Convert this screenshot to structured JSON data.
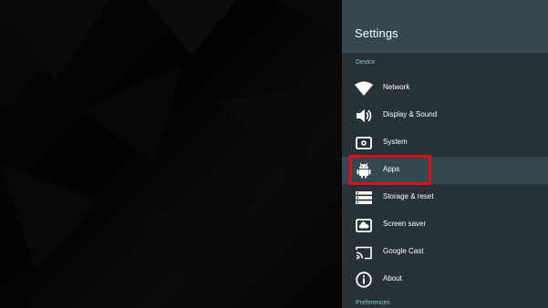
{
  "background": {
    "color": "#050505"
  },
  "settings": {
    "title": "Settings",
    "header_color": "#37474f",
    "panel_color": "#263238",
    "sections": [
      {
        "label": "Device",
        "accent": "#80cbc4"
      },
      {
        "label": "Preferences",
        "accent": "#80cbc4"
      }
    ],
    "items": [
      {
        "label": "Network",
        "icon": "wifi-icon"
      },
      {
        "label": "Display & Sound",
        "icon": "speaker-icon"
      },
      {
        "label": "System",
        "icon": "system-gear-icon"
      },
      {
        "label": "Apps",
        "icon": "android-icon",
        "selected": true
      },
      {
        "label": "Storage & reset",
        "icon": "storage-icon"
      },
      {
        "label": "Screen saver",
        "icon": "cloud-screen-icon"
      },
      {
        "label": "Google Cast",
        "icon": "cast-icon"
      },
      {
        "label": "About",
        "icon": "info-icon"
      }
    ]
  },
  "annotation": {
    "color": "#e00d1b",
    "target": "Apps"
  }
}
